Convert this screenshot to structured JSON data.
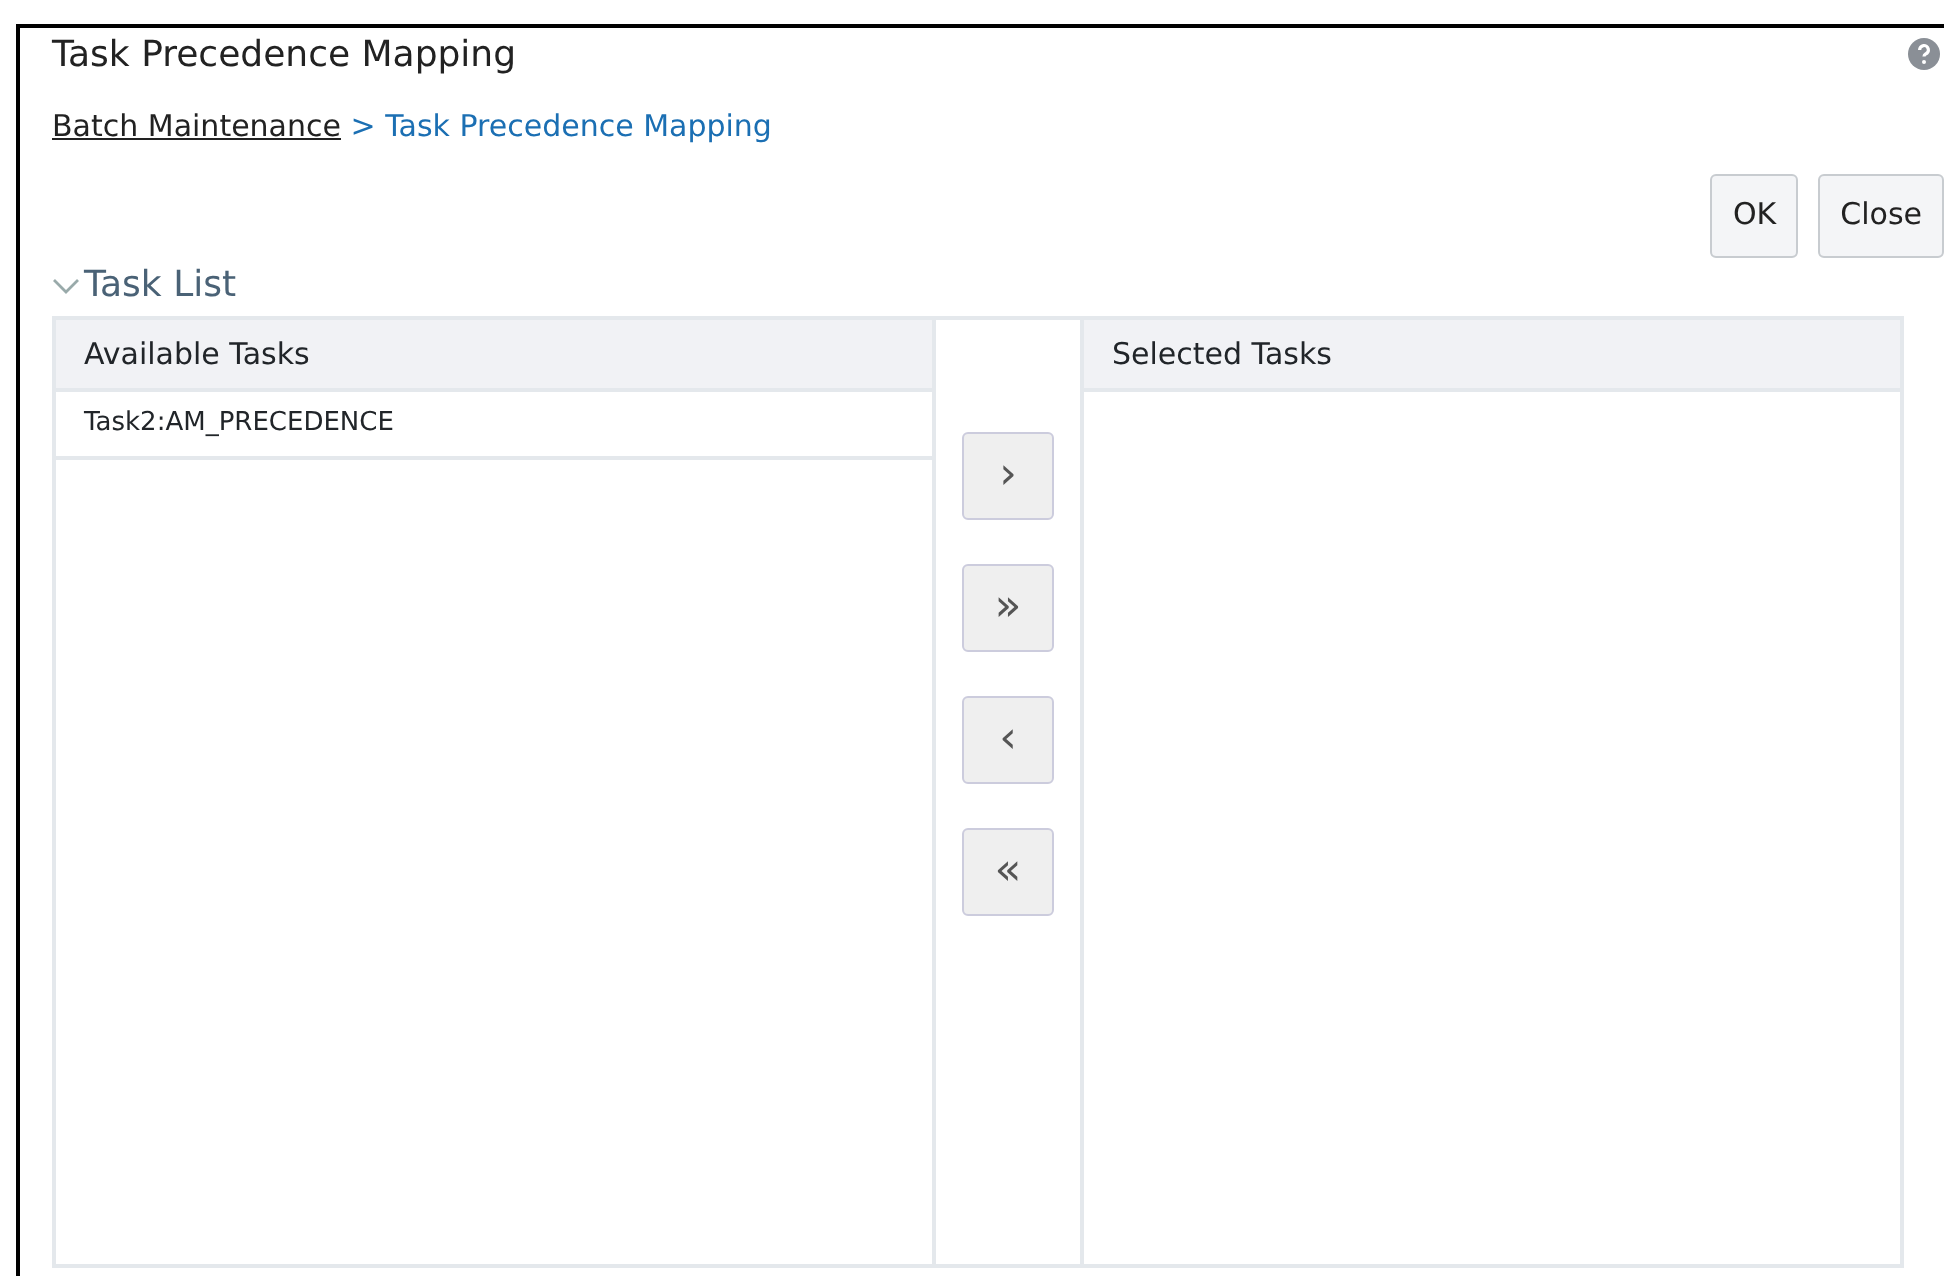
{
  "window": {
    "title": "Task Precedence Mapping"
  },
  "breadcrumb": [
    {
      "label": "Batch Maintenance",
      "kind": "link"
    },
    {
      "label": "> Task Precedence Mapping",
      "kind": "current"
    }
  ],
  "buttons": [
    "OK",
    "Close"
  ],
  "section": {
    "title": "Task List",
    "expanded": true
  },
  "available": {
    "header": "Available Tasks",
    "items": [
      {
        "label": "Task2:AM_PRECEDENCE",
        "selected": false
      }
    ]
  },
  "move_buttons": [
    "›",
    "»",
    "‹",
    "«"
  ],
  "selected": {
    "header": "Selected Tasks"
  }
}
